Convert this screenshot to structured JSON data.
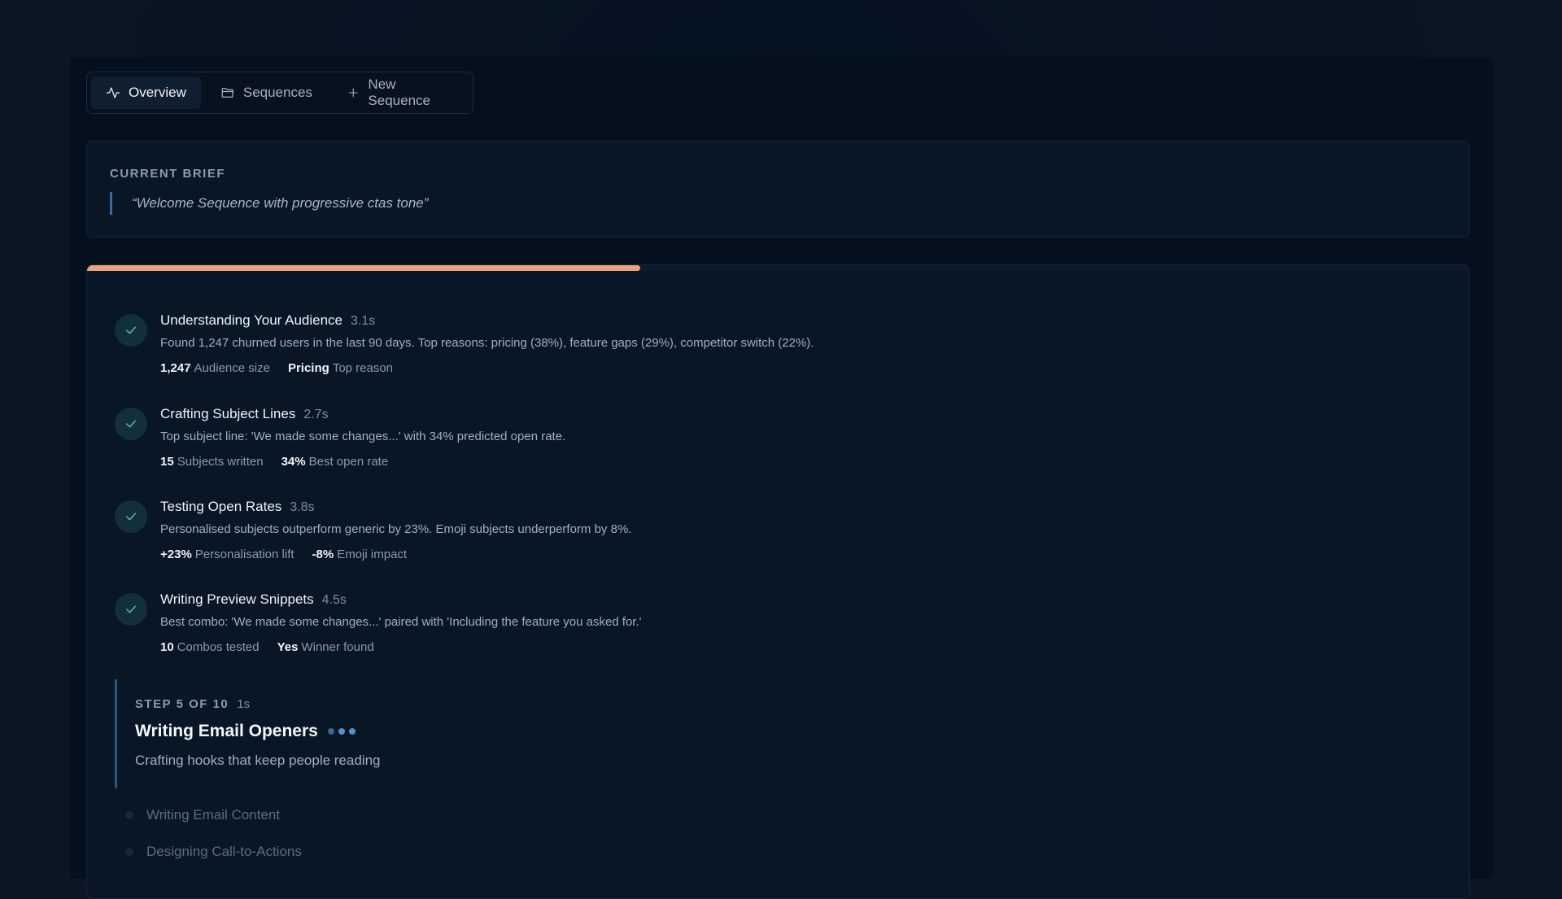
{
  "nav": {
    "tabs": [
      {
        "label": "Overview",
        "icon": "activity-icon",
        "active": true
      },
      {
        "label": "Sequences",
        "icon": "folder-icon",
        "active": false
      },
      {
        "label": "New Sequence",
        "icon": "plus-icon",
        "active": false
      }
    ]
  },
  "brief": {
    "label": "CURRENT BRIEF",
    "quote": "“Welcome Sequence with progressive ctas tone”"
  },
  "progress": {
    "fraction": 0.4
  },
  "steps": [
    {
      "title": "Understanding Your Audience",
      "time": "3.1s",
      "desc": "Found 1,247 churned users in the last 90 days. Top reasons: pricing (38%), feature gaps (29%), competitor switch (22%).",
      "stats": [
        {
          "value": "1,247",
          "label": "Audience size"
        },
        {
          "value": "Pricing",
          "label": "Top reason"
        }
      ]
    },
    {
      "title": "Crafting Subject Lines",
      "time": "2.7s",
      "desc": "Top subject line: 'We made some changes...' with 34% predicted open rate.",
      "stats": [
        {
          "value": "15",
          "label": "Subjects written"
        },
        {
          "value": "34%",
          "label": "Best open rate"
        }
      ]
    },
    {
      "title": "Testing Open Rates",
      "time": "3.8s",
      "desc": "Personalised subjects outperform generic by 23%. Emoji subjects underperform by 8%.",
      "stats": [
        {
          "value": "+23%",
          "label": "Personalisation lift"
        },
        {
          "value": "-8%",
          "label": "Emoji impact"
        }
      ]
    },
    {
      "title": "Writing Preview Snippets",
      "time": "4.5s",
      "desc": "Best combo: 'We made some changes...' paired with 'Including the feature you asked for.'",
      "stats": [
        {
          "value": "10",
          "label": "Combos tested"
        },
        {
          "value": "Yes",
          "label": "Winner found"
        }
      ]
    }
  ],
  "current": {
    "label": "STEP 5 OF 10",
    "time": "1s",
    "title": "Writing Email Openers",
    "subtitle": "Crafting hooks that keep people reading"
  },
  "pending": [
    {
      "label": "Writing Email Content"
    },
    {
      "label": "Designing Call-to-Actions"
    }
  ],
  "colors": {
    "accent": "#e7a47a",
    "check": "#5fb7a4",
    "background": "#0c1624"
  }
}
